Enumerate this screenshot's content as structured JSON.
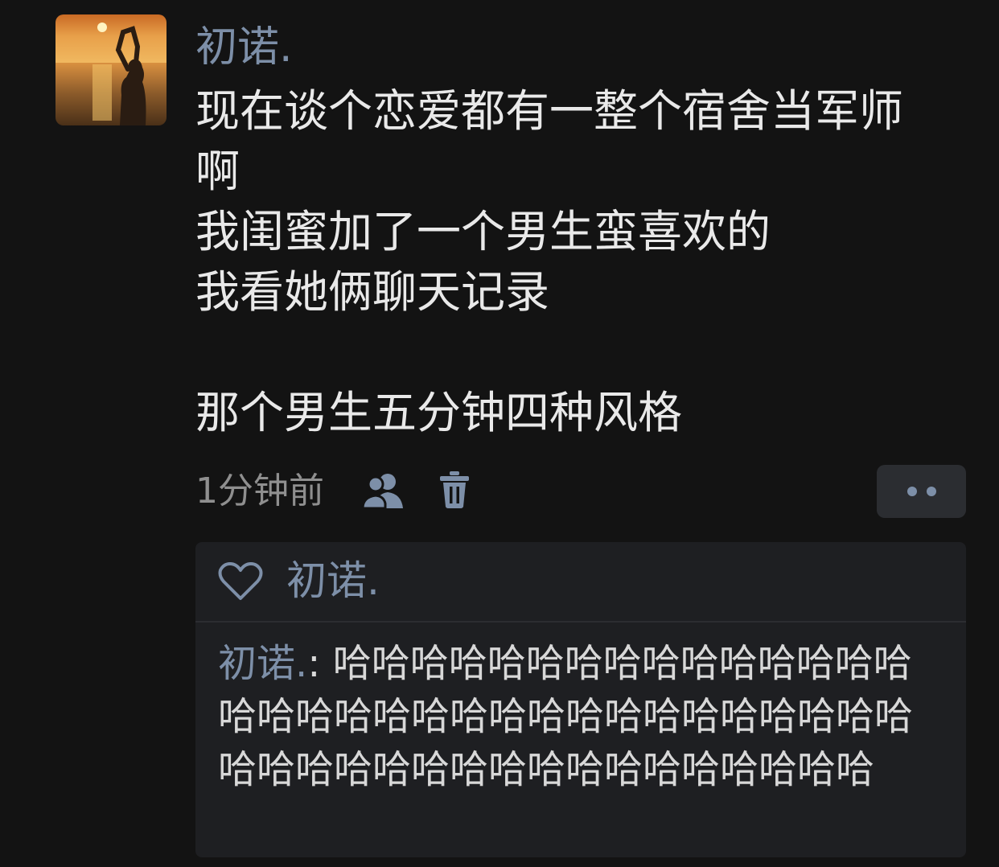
{
  "post": {
    "author": "初诺.",
    "lines": [
      "现在谈个恋爱都有一整个宿舍当军师",
      "啊",
      "我闺蜜加了一个男生蛮喜欢的",
      "我看她俩聊天记录",
      "",
      "那个男生五分钟四种风格"
    ],
    "timestamp": "1分钟前"
  },
  "icons": {
    "visibility": "friends-icon",
    "delete": "trash-icon",
    "more": "more-dots-icon",
    "like": "heart-icon"
  },
  "likes": {
    "names": "初诺."
  },
  "comments": [
    {
      "author": "初诺.",
      "separator": ": ",
      "text": "哈哈哈哈哈哈哈哈哈哈哈哈哈哈哈哈哈哈哈哈哈哈哈哈哈哈哈哈哈哈哈哈哈哈哈哈哈哈哈哈哈哈哈哈哈哈哈哈哈哈"
    }
  ],
  "colors": {
    "background": "#131313",
    "name_accent": "#7d8fa8",
    "panel": "#1e1f22",
    "button": "#2b2d31"
  }
}
